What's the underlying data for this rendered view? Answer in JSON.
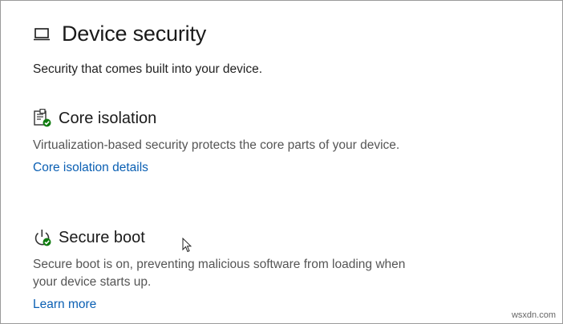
{
  "page": {
    "title": "Device security",
    "subtitle": "Security that comes built into your device."
  },
  "sections": [
    {
      "heading": "Core isolation",
      "description": "Virtualization-based security protects the core parts of your device.",
      "link": "Core isolation details",
      "icon": "core-isolation-icon",
      "status": "ok"
    },
    {
      "heading": "Secure boot",
      "description": "Secure boot is on, preventing malicious software from loading when your device starts up.",
      "link": "Learn more",
      "icon": "power-icon",
      "status": "ok"
    }
  ],
  "watermark": "wsxdn.com",
  "colors": {
    "link": "#0a5fb3",
    "status_ok": "#107c10"
  }
}
